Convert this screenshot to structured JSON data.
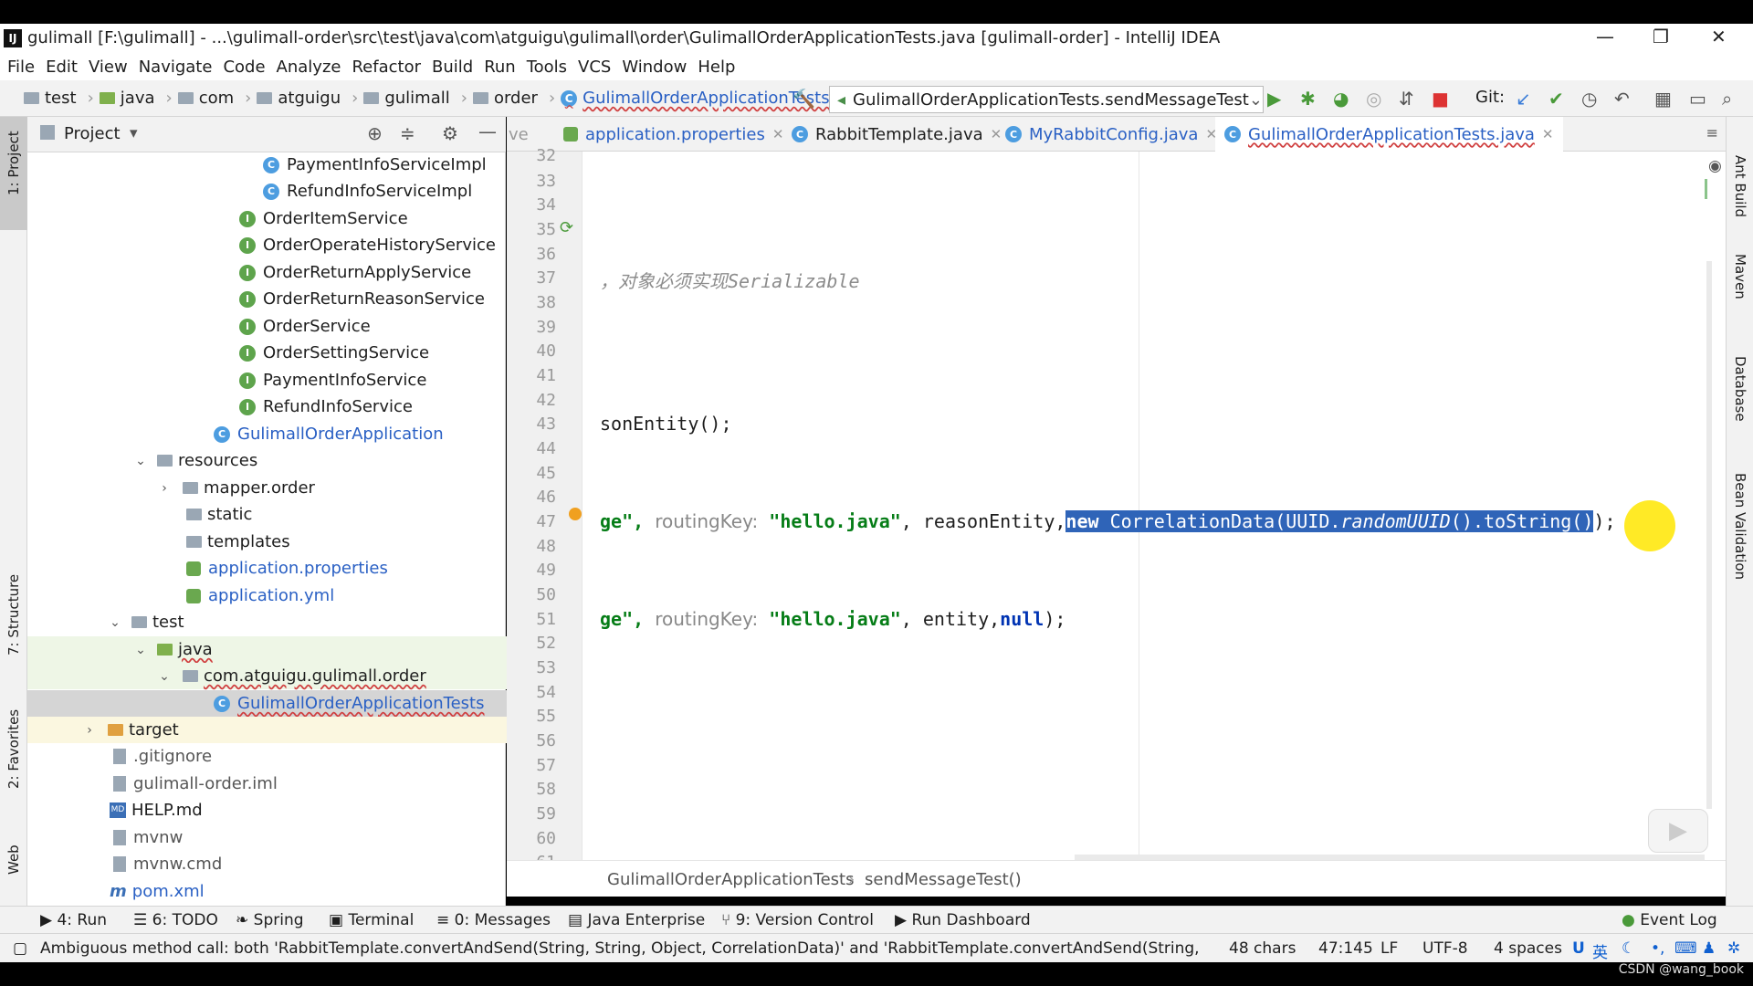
{
  "window": {
    "title": "gulimall [F:\\gulimall] - ...\\gulimall-order\\src\\test\\java\\com\\atguigu\\gulimall\\order\\GulimallOrderApplicationTests.java [gulimall-order] - IntelliJ IDEA",
    "app_icon": "IJ"
  },
  "menu": [
    "File",
    "Edit",
    "View",
    "Navigate",
    "Code",
    "Analyze",
    "Refactor",
    "Build",
    "Run",
    "Tools",
    "VCS",
    "Window",
    "Help"
  ],
  "nav": {
    "crumbs": [
      "test",
      "java",
      "com",
      "atguigu",
      "gulimall",
      "order"
    ],
    "current_class": "GulimallOrderApplicationTests",
    "run_config": "GulimallOrderApplicationTests.sendMessageTest",
    "git_label": "Git:"
  },
  "project": {
    "header": "Project",
    "tree": [
      {
        "label": "PaymentInfoServiceImpl",
        "icon": "c"
      },
      {
        "label": "RefundInfoServiceImpl",
        "icon": "c"
      },
      {
        "label": "OrderItemService",
        "icon": "i"
      },
      {
        "label": "OrderOperateHistoryService",
        "icon": "i"
      },
      {
        "label": "OrderReturnApplyService",
        "icon": "i"
      },
      {
        "label": "OrderReturnReasonService",
        "icon": "i"
      },
      {
        "label": "OrderService",
        "icon": "i"
      },
      {
        "label": "OrderSettingService",
        "icon": "i"
      },
      {
        "label": "PaymentInfoService",
        "icon": "i"
      },
      {
        "label": "RefundInfoService",
        "icon": "i"
      },
      {
        "label": "GulimallOrderApplication",
        "icon": "c"
      },
      {
        "label": "resources",
        "icon": "folder"
      },
      {
        "label": "mapper.order",
        "icon": "folder"
      },
      {
        "label": "static",
        "icon": "folder"
      },
      {
        "label": "templates",
        "icon": "folder"
      },
      {
        "label": "application.properties",
        "icon": "prop"
      },
      {
        "label": "application.yml",
        "icon": "prop"
      },
      {
        "label": "test",
        "icon": "folder"
      },
      {
        "label": "java",
        "icon": "folder-green"
      },
      {
        "label": "com.atguigu.gulimall.order",
        "icon": "folder"
      },
      {
        "label": "GulimallOrderApplicationTests",
        "icon": "c"
      },
      {
        "label": "target",
        "icon": "folder-orange"
      },
      {
        "label": ".gitignore",
        "icon": "file"
      },
      {
        "label": "gulimall-order.iml",
        "icon": "file"
      },
      {
        "label": "HELP.md",
        "icon": "md"
      },
      {
        "label": "mvnw",
        "icon": "file"
      },
      {
        "label": "mvnw.cmd",
        "icon": "file"
      },
      {
        "label": "pom.xml",
        "icon": "maven"
      }
    ]
  },
  "tabs": [
    {
      "label": "ve",
      "active": false
    },
    {
      "label": "application.properties",
      "active": false
    },
    {
      "label": "RabbitTemplate.java",
      "active": false
    },
    {
      "label": "MyRabbitConfig.java",
      "active": false
    },
    {
      "label": "GulimallOrderApplicationTests.java",
      "active": true
    }
  ],
  "editor": {
    "line_numbers": [
      "32",
      "33",
      "34",
      "35",
      "36",
      "37",
      "38",
      "39",
      "40",
      "41",
      "42",
      "43",
      "44",
      "45",
      "46",
      "47",
      "48",
      "49",
      "50",
      "51",
      "52",
      "53",
      "54",
      "55",
      "56",
      "57",
      "58",
      "59",
      "60",
      "61"
    ],
    "line37": "，对象必须实现Serializable",
    "line43": "sonEntity();",
    "line47": {
      "a": "ge\",",
      "hint": "routingKey:",
      "b": "\"hello.java\"",
      "c": ", reasonEntity,",
      "sel_kw": "new",
      "sel_rest": " CorrelationData(UUID.",
      "sel_ital": "randomUUID",
      "sel_tail": "().toString()",
      "end": ");"
    },
    "line51": {
      "a": "ge\",",
      "hint": "routingKey:",
      "b": "\"hello.java\"",
      "c": ", entity,",
      "kw": "null",
      "end": ");"
    }
  },
  "editor_crumb": [
    "GulimallOrderApplicationTests",
    "sendMessageTest()"
  ],
  "tool_tabs": [
    "4: Run",
    "6: TODO",
    "Spring",
    "Terminal",
    "0: Messages",
    "Java Enterprise",
    "9: Version Control",
    "Run Dashboard",
    "Event Log"
  ],
  "side_tabs_left": [
    "1: Project",
    "7: Structure",
    "2: Favorites",
    "Web"
  ],
  "side_tabs_right": [
    "Ant Build",
    "Maven",
    "Database",
    "Bean Validation"
  ],
  "status": {
    "message": "Ambiguous method call: both 'RabbitTemplate.convertAndSend(String, String, Object, CorrelationData)' and 'RabbitTemplate.convertAndSend(String, Strin...",
    "chars": "48 chars",
    "position": "47:145",
    "line_sep": "LF",
    "encoding": "UTF-8",
    "indent": "4 spaces",
    "ime": "英"
  },
  "watermark": "CSDN @wang_book"
}
